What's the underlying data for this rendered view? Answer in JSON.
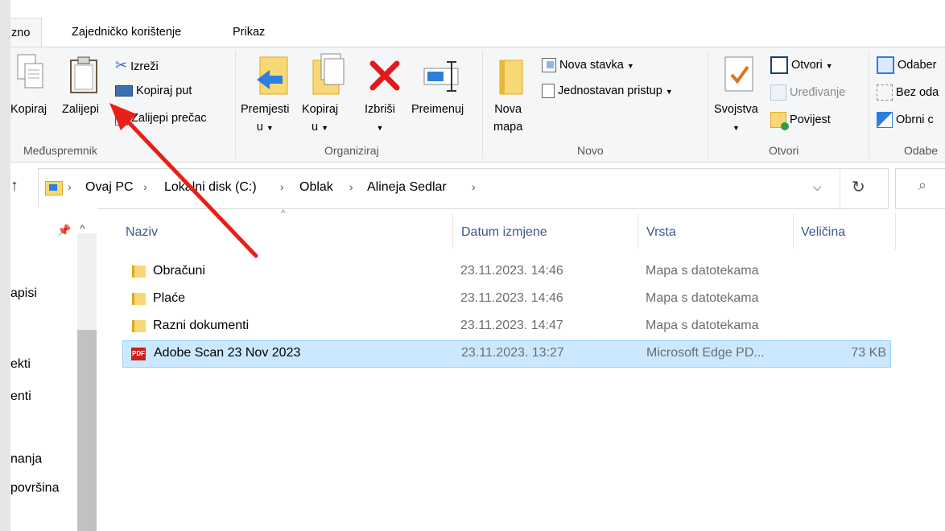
{
  "tabs": [
    {
      "label": "zno",
      "active": true
    },
    {
      "label": "Zajedničko korištenje",
      "active": false
    },
    {
      "label": "Prikaz",
      "active": false
    }
  ],
  "ribbon": {
    "clipboard": {
      "group_label": "Međuspremnik",
      "copy": "Kopiraj",
      "paste": "Zalijepi",
      "cut": "Izreži",
      "copy_path": "Kopiraj put",
      "paste_shortcut": "Zalijepi prečac"
    },
    "organize": {
      "group_label": "Organiziraj",
      "move_to": "Premjesti",
      "move_to_line2": "u",
      "copy_to": "Kopiraj",
      "copy_to_line2": "u",
      "delete": "Izbriši",
      "rename": "Preimenuj"
    },
    "new": {
      "group_label": "Novo",
      "new_folder": "Nova",
      "new_folder_line2": "mapa",
      "new_item": "Nova stavka",
      "easy_access": "Jednostavan pristup"
    },
    "open": {
      "group_label": "Otvori",
      "properties": "Svojstva",
      "open": "Otvori",
      "edit": "Uređivanje",
      "history": "Povijest"
    },
    "select": {
      "group_label": "Odabe",
      "select_all": "Odaber",
      "select_none": "Bez oda",
      "invert": "Obrni c"
    }
  },
  "address": {
    "crumbs": [
      "Ovaj PC",
      "Lokalni disk (C:)",
      "Oblak",
      "Alineja Sedlar"
    ]
  },
  "nav": {
    "items": [
      "apisi",
      "ekti",
      "enti",
      "nanja",
      "površina"
    ]
  },
  "columns": {
    "name": "Naziv",
    "date": "Datum izmjene",
    "type": "Vrsta",
    "size": "Veličina"
  },
  "files": [
    {
      "name": "Obračuni",
      "date": "23.11.2023. 14:46",
      "type": "Mapa s datotekama",
      "size": "",
      "icon": "folder-icon"
    },
    {
      "name": "Plaće",
      "date": "23.11.2023. 14:46",
      "type": "Mapa s datotekama",
      "size": "",
      "icon": "folder-icon"
    },
    {
      "name": "Razni dokumenti",
      "date": "23.11.2023. 14:47",
      "type": "Mapa s datotekama",
      "size": "",
      "icon": "folder-icon"
    },
    {
      "name": "Adobe Scan 23 Nov 2023",
      "date": "23.11.2023. 13:27",
      "type": "Microsoft Edge PD...",
      "size": "73 KB",
      "icon": "pdf-icon",
      "selected": true
    }
  ],
  "colors": {
    "selection_bg": "#cce8ff",
    "selection_border": "#99d1ff",
    "header_text": "#3a5a8a",
    "annotation_arrow": "#e8201a"
  }
}
